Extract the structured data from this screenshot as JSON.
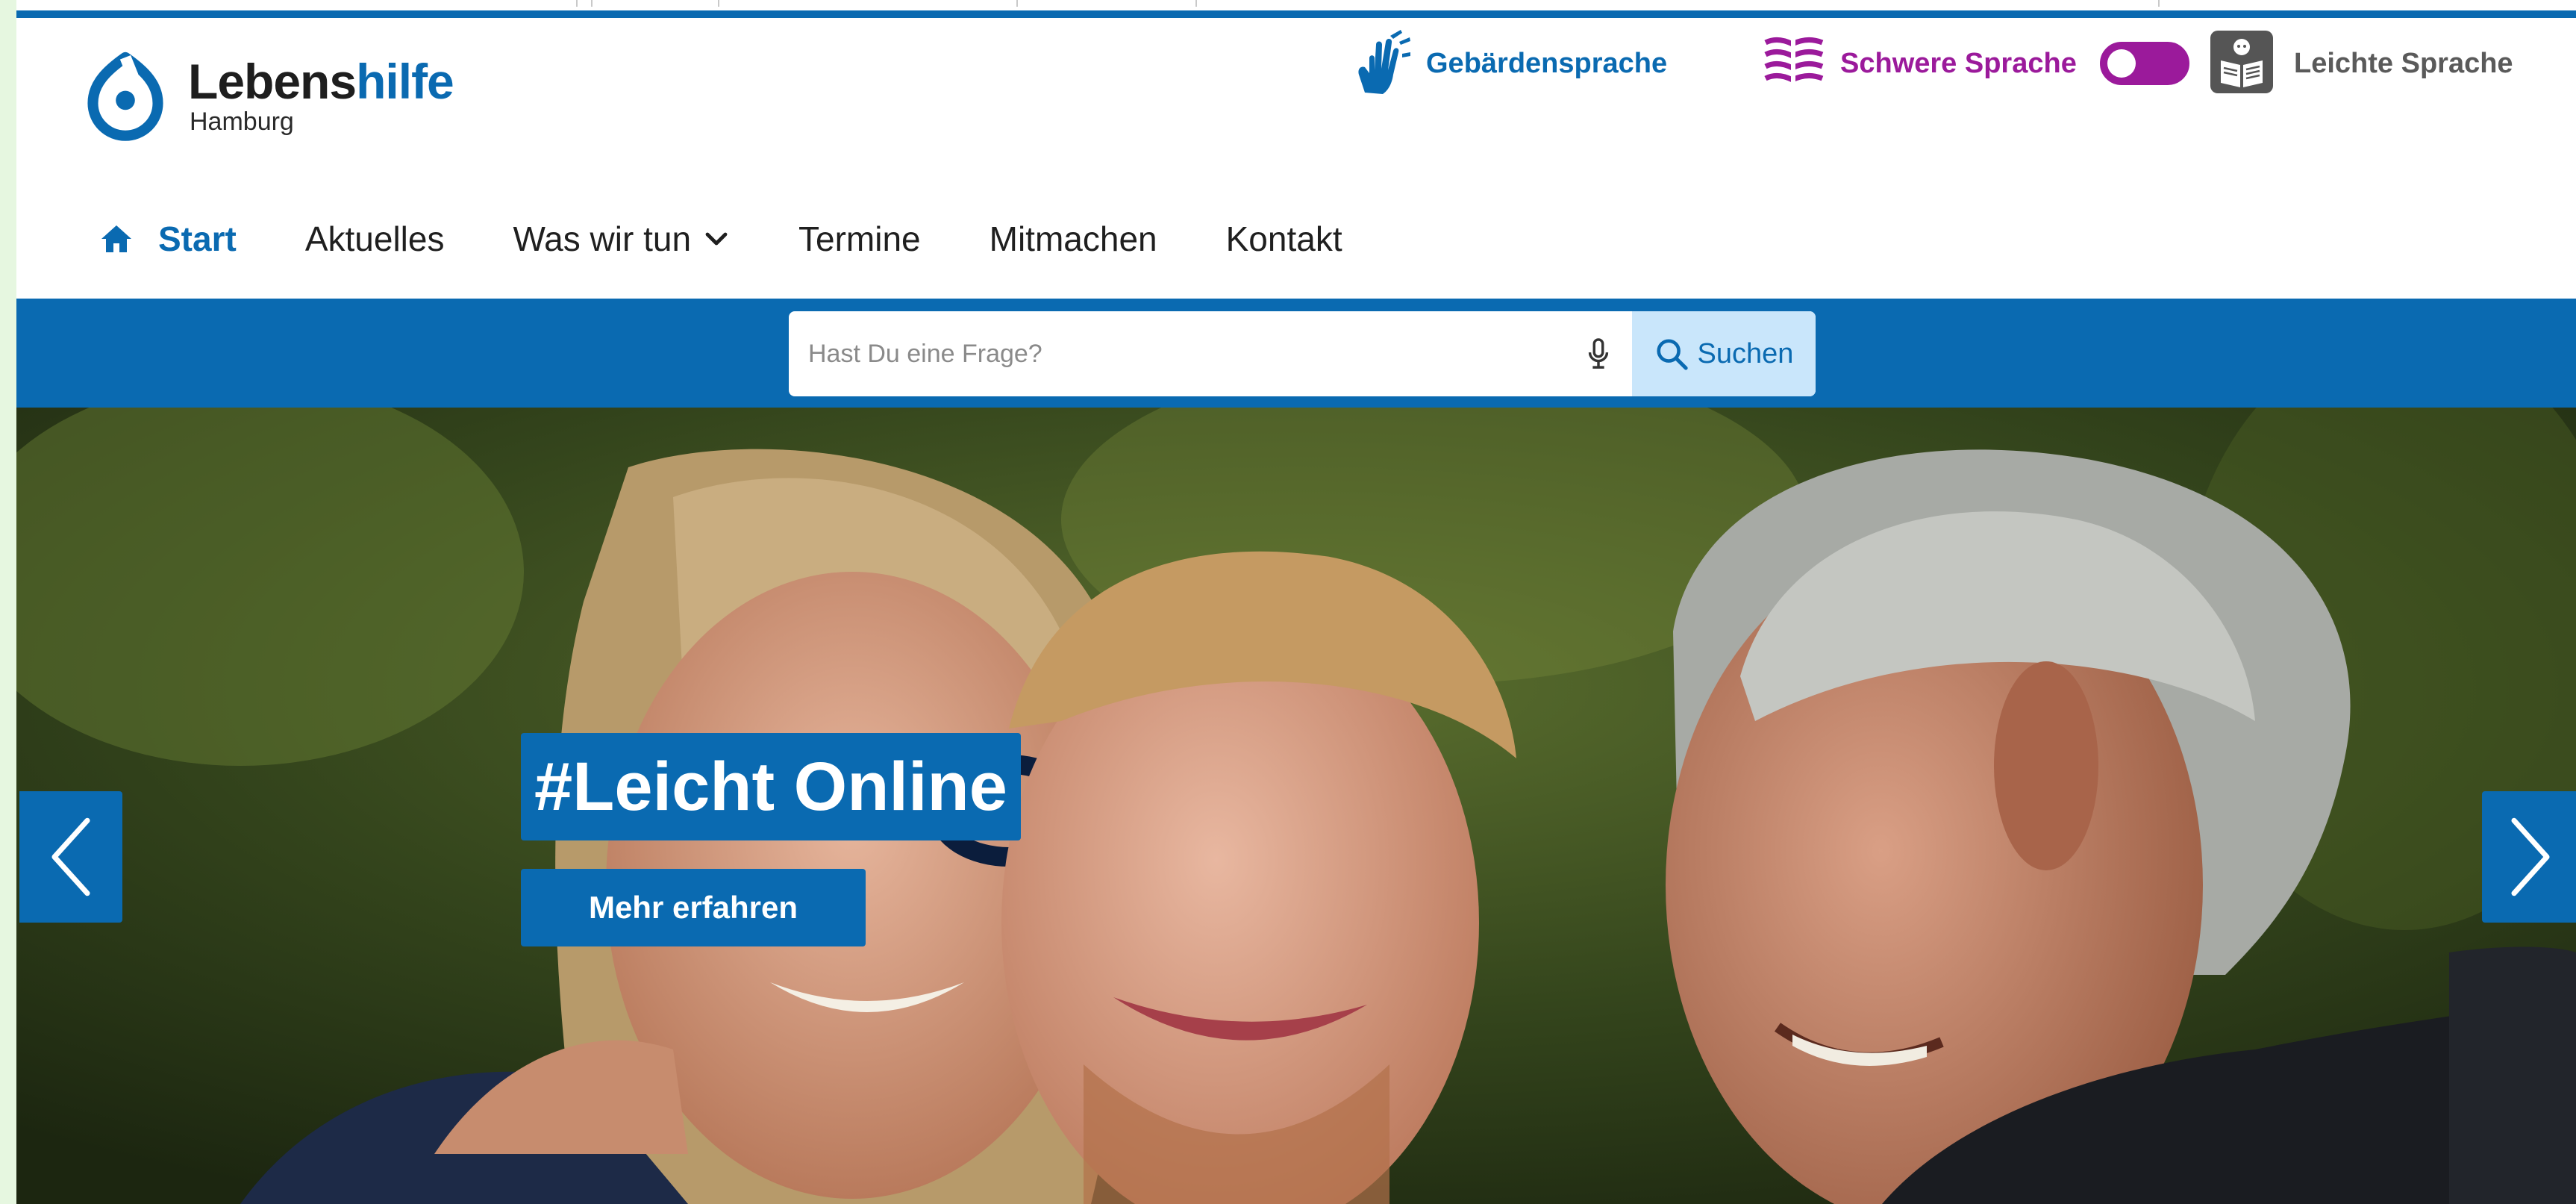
{
  "brand": {
    "name_part1": "Lebens",
    "name_part2": "hilfe",
    "city": "Hamburg",
    "color_primary": "#0a6ab1",
    "color_schwere": "#9b1a9b"
  },
  "language_options": {
    "gebaerden": {
      "label": "Gebärdensprache",
      "icon": "sign-language-hands-icon"
    },
    "schwere": {
      "label": "Schwere Sprache",
      "icon": "schwere-sprache-book-icon"
    },
    "toggle": {
      "state": "schwere"
    },
    "leichte": {
      "label": "Leichte Sprache",
      "icon": "leichte-sprache-reader-icon"
    }
  },
  "nav": {
    "items": [
      {
        "label": "Start",
        "icon": "home-icon",
        "active": true
      },
      {
        "label": "Aktuelles"
      },
      {
        "label": "Was wir tun",
        "icon": "chevron-down-icon"
      },
      {
        "label": "Termine"
      },
      {
        "label": "Mitmachen"
      },
      {
        "label": "Kontakt"
      }
    ]
  },
  "search": {
    "placeholder": "Hast Du eine Frage?",
    "value": "",
    "button_label": "Suchen",
    "mic_icon": "microphone-icon",
    "search_icon": "magnifier-icon"
  },
  "hero": {
    "title": "#Leicht Online",
    "cta_label": "Mehr erfahren",
    "prev_icon": "chevron-left-icon",
    "next_icon": "chevron-right-icon"
  }
}
